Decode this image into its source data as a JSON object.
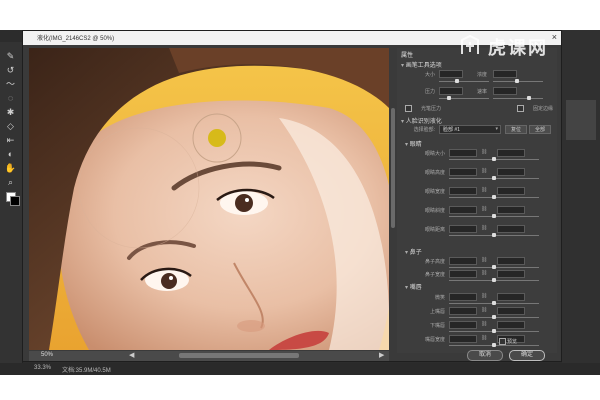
{
  "app": {
    "dialog_title": "液化(IMG_2146CS2 @ 50%)",
    "close_glyph": "×"
  },
  "canvas": {
    "zoom": "50%",
    "scroll_left_glyph": "◀",
    "scroll_right_glyph": "▶"
  },
  "panel": {
    "title": "属性",
    "brush_section": "画笔工具选项",
    "brush_rows": [
      {
        "label": "大小",
        "value": "100"
      },
      {
        "label": "压力",
        "value": "25"
      },
      {
        "label": "浓度",
        "value": "50"
      },
      {
        "label": "速率",
        "value": ""
      }
    ],
    "pen_pressure_label": "光笔压力",
    "pin_edges_label": "固定边缘",
    "face_section": "人脸识别液化",
    "select_face_label": "选择脸部:",
    "select_face_value": "脸部 #1",
    "reset_label": "复位",
    "all_label": "全部",
    "eyes_section": "眼睛",
    "eye_rows": [
      "眼睛大小",
      "眼睛高度",
      "眼睛宽度",
      "眼睛斜度",
      "眼睛距离"
    ],
    "nose_section": "鼻子",
    "nose_rows": [
      "鼻子高度",
      "鼻子宽度"
    ],
    "mouth_section": "嘴唇",
    "mouth_rows": [
      "微笑",
      "上嘴唇",
      "下嘴唇",
      "嘴唇宽度"
    ],
    "preview_label": "预览",
    "cancel_label": "取消",
    "ok_label": "确定"
  },
  "watermark": {
    "text": "虎课网"
  },
  "status": {
    "zoom": "33.3%",
    "doc": "文档:35.9M/40.5M"
  },
  "colors": {
    "accent": "#d4b800",
    "lip": "#c84a44"
  }
}
